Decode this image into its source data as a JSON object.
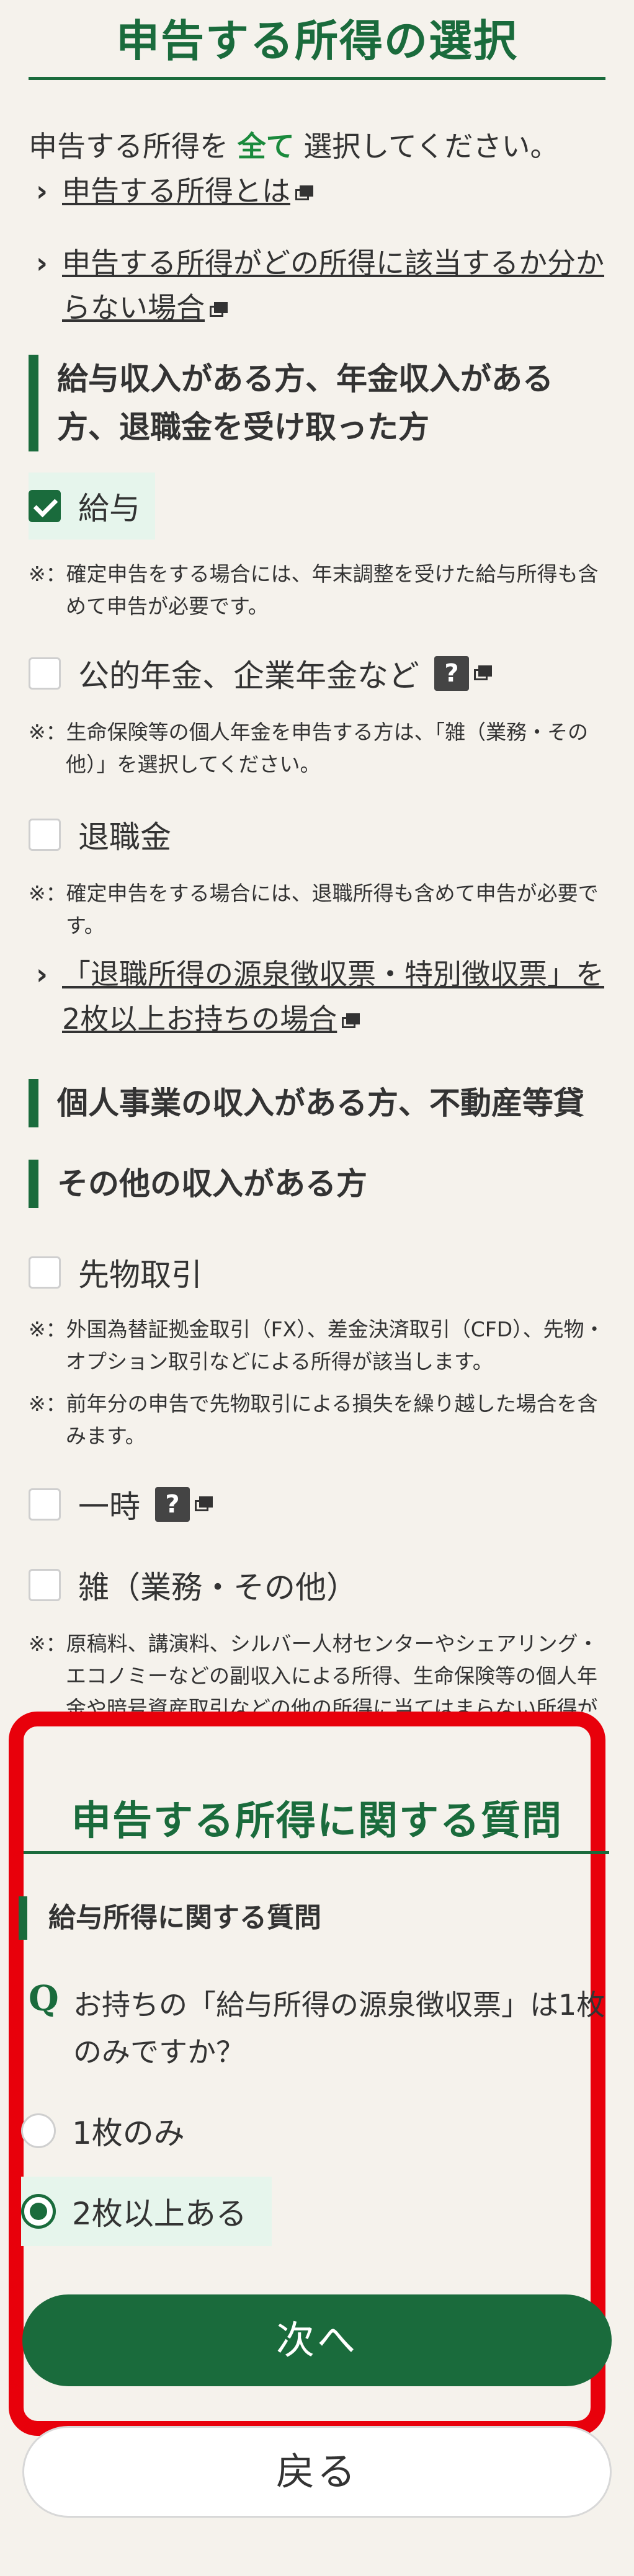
{
  "page": {
    "title": "申告する所得の選択",
    "intro_before": "申告する所得を ",
    "intro_emph": "全て",
    "intro_after": " 選択してください。",
    "links": [
      {
        "label": "申告する所得とは"
      },
      {
        "label_line1": "申告する所得がどの所得に該当するか分か",
        "label_line2": "らない場合"
      }
    ]
  },
  "section_salary": {
    "heading_line1": "給与収入がある方、年金収入がある",
    "heading_line2": "方、退職金を受け取った方",
    "items": [
      {
        "label": "給与",
        "checked": true,
        "note_mark": "※：",
        "note": "確定申告をする場合には、年末調整を受けた給与所得も含めて申告が必要です。"
      },
      {
        "label": "公的年金、企業年金など",
        "help": "?",
        "checked": false,
        "note_mark": "※：",
        "note": "生命保険等の個人年金を申告する方は、「雑（業務・その他）」を選択してください。"
      },
      {
        "label": "退職金",
        "checked": false,
        "note_mark": "※：",
        "note": "確定申告をする場合には、退職所得も含めて申告が必要です。"
      }
    ],
    "retire_link_line1": "「退職所得の源泉徴収票・特別徴収票」を",
    "retire_link_line2": "2枚以上お持ちの場合"
  },
  "section_business": {
    "heading": "個人事業の収入がある方、不動産等貸"
  },
  "section_other": {
    "heading": "その他の収入がある方",
    "items": [
      {
        "label": "先物取引",
        "checked": false
      },
      {
        "label": "一時",
        "help": "?",
        "checked": false
      },
      {
        "label": "雑（業務・その他）",
        "checked": false
      }
    ],
    "futures_notes": [
      {
        "mark": "※：",
        "text": "外国為替証拠金取引（FX）、差金決済取引（CFD）、先物・オプション取引などによる所得が該当します。"
      },
      {
        "mark": "※：",
        "text": "前年分の申告で先物取引による損失を繰り越した場合を含みます。"
      }
    ],
    "misc_note_mark": "※：",
    "misc_note": "原稿料、講演料、シルバー人材センターやシェアリング・エコノミーなどの副収入による所得、生命保険等の個人年金や暗号資産取引などの他の所得に当てはまらない所得が該当します。"
  },
  "questions": {
    "title": "申告する所得に関する質問",
    "subheading": "給与所得に関する質問",
    "q_mark": "Q",
    "question": "お持ちの「給与所得の源泉徴収票」は1枚のみですか？",
    "options": [
      {
        "label": "1枚のみ",
        "selected": false
      },
      {
        "label": "2枚以上ある",
        "selected": true
      }
    ]
  },
  "buttons": {
    "next": "次へ",
    "back": "戻る"
  },
  "colors": {
    "brand_green": "#1a6b3c",
    "highlight_red": "#e8000b",
    "background": "#f5f2ec"
  }
}
